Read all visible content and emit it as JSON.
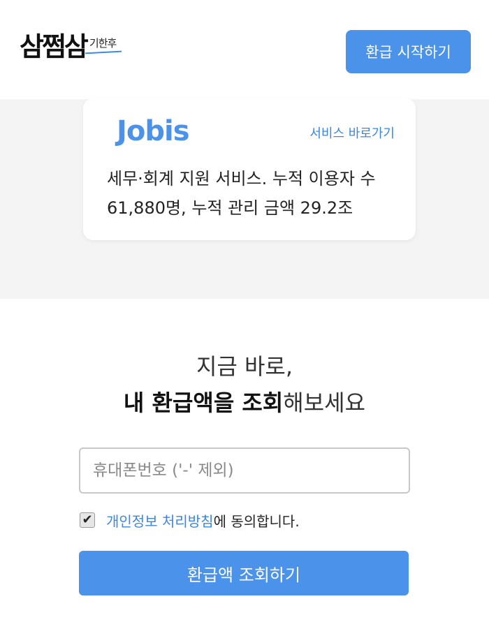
{
  "header": {
    "logo_main": "삼쩜삼",
    "logo_sub": "기한후",
    "cta_label": "환급 시작하기"
  },
  "partner_card": {
    "brand": "Jobis",
    "link_label": "서비스 바로가기",
    "description": "세무·회계 지원 서비스. 누적 이용자 수 61,880명, 누적 관리 금액 29.2조"
  },
  "lookup": {
    "headline_line1": "지금 바로,",
    "headline_line2_bold": "내 환급액을 조회",
    "headline_line2_rest": "해보세요",
    "phone_placeholder": "휴대폰번호 ('-' 제외)",
    "phone_value": "",
    "agree_checked": true,
    "agree_checkmark": "✔",
    "agree_link": "개인정보 처리방침",
    "agree_rest": "에 동의합니다.",
    "submit_label": "환급액 조회하기"
  },
  "colors": {
    "accent": "#4b93ea",
    "link": "#3b86e0",
    "band": "#f4f4f4"
  }
}
